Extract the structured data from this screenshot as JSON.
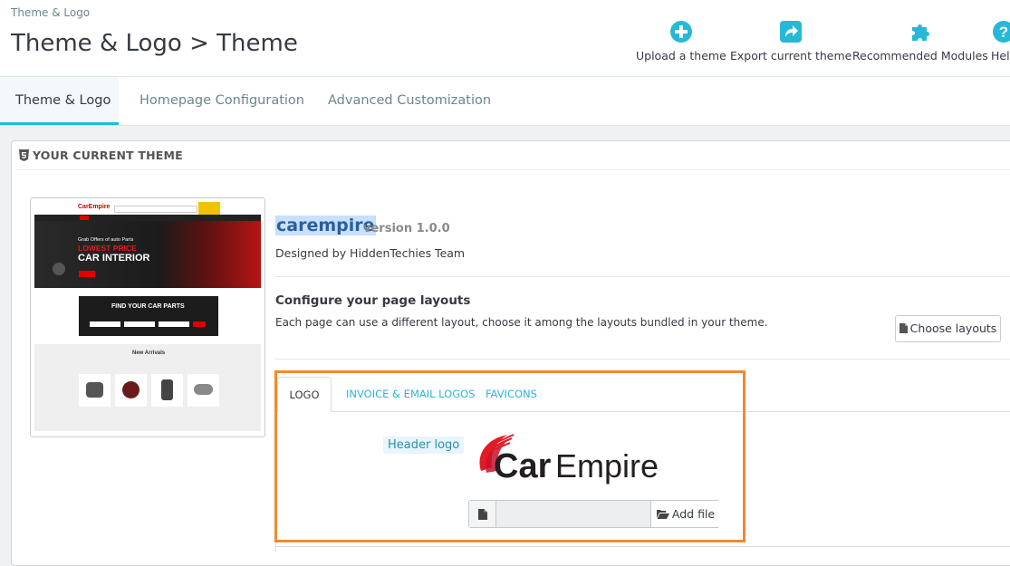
{
  "header": {
    "breadcrumb": "Theme & Logo",
    "title": "Theme & Logo > Theme",
    "toolbar": [
      {
        "label": "Upload a theme",
        "icon": "plus-circle-icon"
      },
      {
        "label": "Export current theme",
        "icon": "share-icon"
      },
      {
        "label": "Recommended Modules",
        "icon": "puzzle-icon"
      },
      {
        "label": "Help",
        "icon": "help-icon"
      }
    ]
  },
  "tabs": [
    {
      "label": "Theme & Logo",
      "active": true
    },
    {
      "label": "Homepage Configuration",
      "active": false
    },
    {
      "label": "Advanced Customization",
      "active": false
    }
  ],
  "panel": {
    "heading": "YOUR CURRENT THEME",
    "theme_name": "carempire",
    "version": "version 1.0.0",
    "designed_by": "Designed by HiddenTechies Team",
    "configure_title": "Configure your page layouts",
    "configure_desc": "Each page can use a different layout, choose it among the layouts bundled in your theme.",
    "choose_layouts": "Choose layouts"
  },
  "preview": {
    "brand": "CarEmpire",
    "banner_small": "Grab Offers of auto Parts",
    "banner_red": "LOWEST PRICE",
    "banner_main": "CAR INTERIOR",
    "find_title": "FIND YOUR CAR PARTS",
    "new_arrivals": "New Arrivals"
  },
  "logo_tabs": [
    {
      "label": "LOGO",
      "active": true
    },
    {
      "label": "INVOICE & EMAIL LOGOS",
      "active": false
    },
    {
      "label": "FAVICONS",
      "active": false
    }
  ],
  "logo": {
    "header_logo_label": "Header logo",
    "logo_text_car": "Car",
    "logo_text_empire": "Empire",
    "add_file": "Add file"
  },
  "colors": {
    "accent": "#25b9d7",
    "highlight_box": "#f28a2e"
  }
}
